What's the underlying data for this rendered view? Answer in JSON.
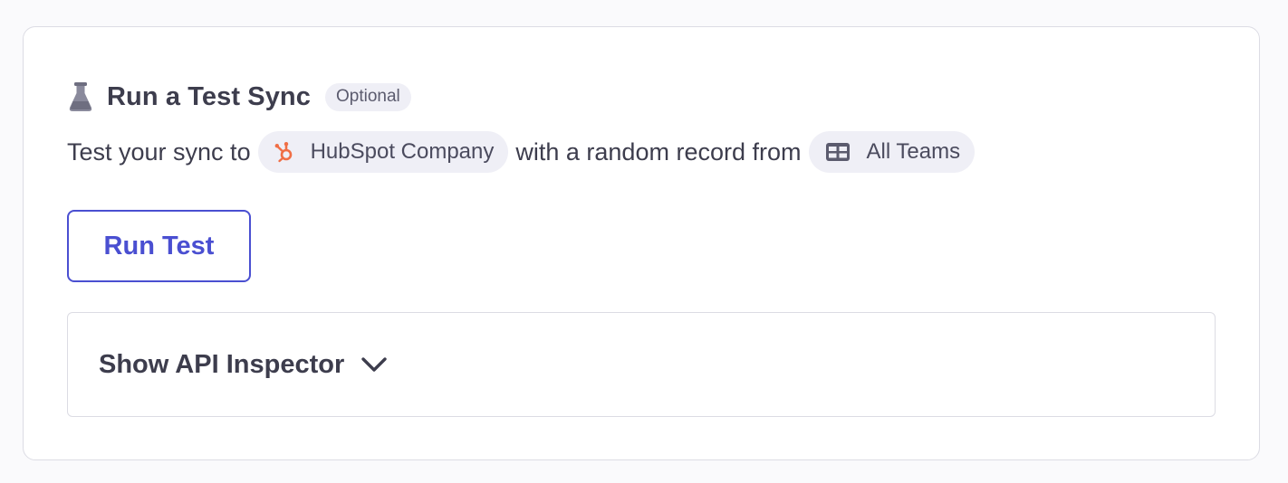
{
  "section": {
    "title": "Run a Test Sync",
    "icon": "flask-icon",
    "badge": "Optional"
  },
  "description": {
    "prefix": "Test your sync to",
    "destination": {
      "label": "HubSpot Company",
      "icon": "hubspot-icon",
      "icon_color": "#f06e45"
    },
    "middle": "with a random record from",
    "source": {
      "label": "All Teams",
      "icon": "table-icon"
    }
  },
  "actions": {
    "run_test_label": "Run Test"
  },
  "inspector": {
    "label": "Show API Inspector",
    "icon": "chevron-down-icon",
    "expanded": false
  },
  "colors": {
    "accent": "#4a4fd1",
    "chip_bg": "#efeff6",
    "border": "#dcdce4",
    "text": "#3d3d4d"
  }
}
